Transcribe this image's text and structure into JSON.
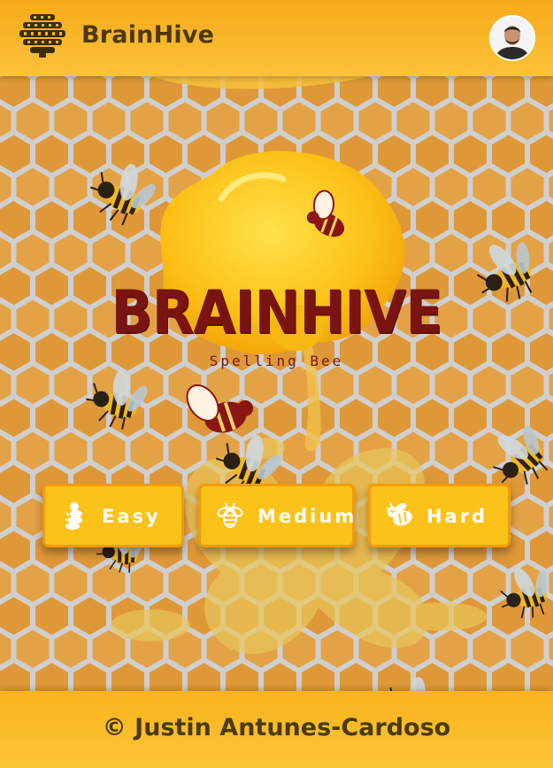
{
  "header": {
    "brand_name": "BrainHive",
    "brand_icon": "honeycomb-hive-icon",
    "avatar": "user-avatar"
  },
  "hero": {
    "logo_title": "BRAINHIVE",
    "logo_subtitle": "Spelling Bee",
    "background": "honeycomb-pattern-with-bees"
  },
  "difficulty": {
    "easy": {
      "label": "Easy",
      "icon": "larva-icon"
    },
    "medium": {
      "label": "Medium",
      "icon": "bee-icon"
    },
    "hard": {
      "label": "Hard",
      "icon": "angry-bee-icon"
    }
  },
  "footer": {
    "text": "© Justin Antunes-Cardoso"
  },
  "colors": {
    "header_bg": "#f9b21c",
    "button_bg": "#fbc21a",
    "button_border": "#f39a0c",
    "honeycomb": "#e19a3a",
    "logo_text": "#7a1410",
    "brand_text": "#4b3a08"
  }
}
